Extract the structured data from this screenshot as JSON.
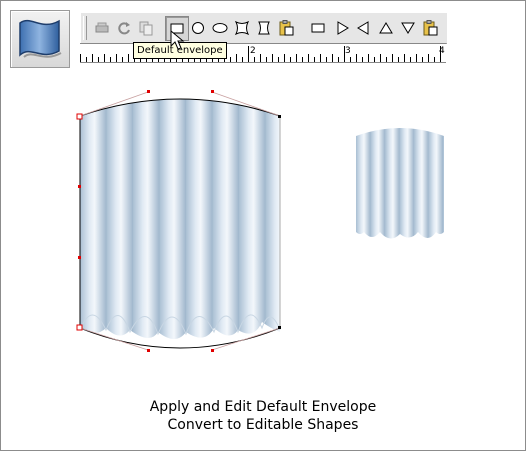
{
  "toolbar": {
    "tooltip": "Default envelope",
    "tools": [
      {
        "icon": "toggle-pressure-icon"
      },
      {
        "icon": "redo-icon"
      },
      {
        "icon": "copy-icon"
      },
      {
        "icon": "default-envelope-icon",
        "selected": true
      },
      {
        "icon": "circle-envelope-icon"
      },
      {
        "icon": "ellipse-envelope-icon"
      },
      {
        "icon": "hourglass-envelope-icon"
      },
      {
        "icon": "bow-envelope-icon"
      },
      {
        "icon": "paste-envelope-icon"
      },
      {
        "icon": "rectangle-icon"
      },
      {
        "icon": "triangle-right-icon"
      },
      {
        "icon": "triangle-left-icon"
      },
      {
        "icon": "triangle-up-icon"
      },
      {
        "icon": "triangle-down-icon"
      },
      {
        "icon": "paste-shape-icon"
      }
    ]
  },
  "ruler": {
    "labels": [
      "2",
      "3",
      "4"
    ]
  },
  "caption": {
    "line1": "Apply and Edit Default Envelope",
    "line2": "Convert to Editable Shapes"
  }
}
